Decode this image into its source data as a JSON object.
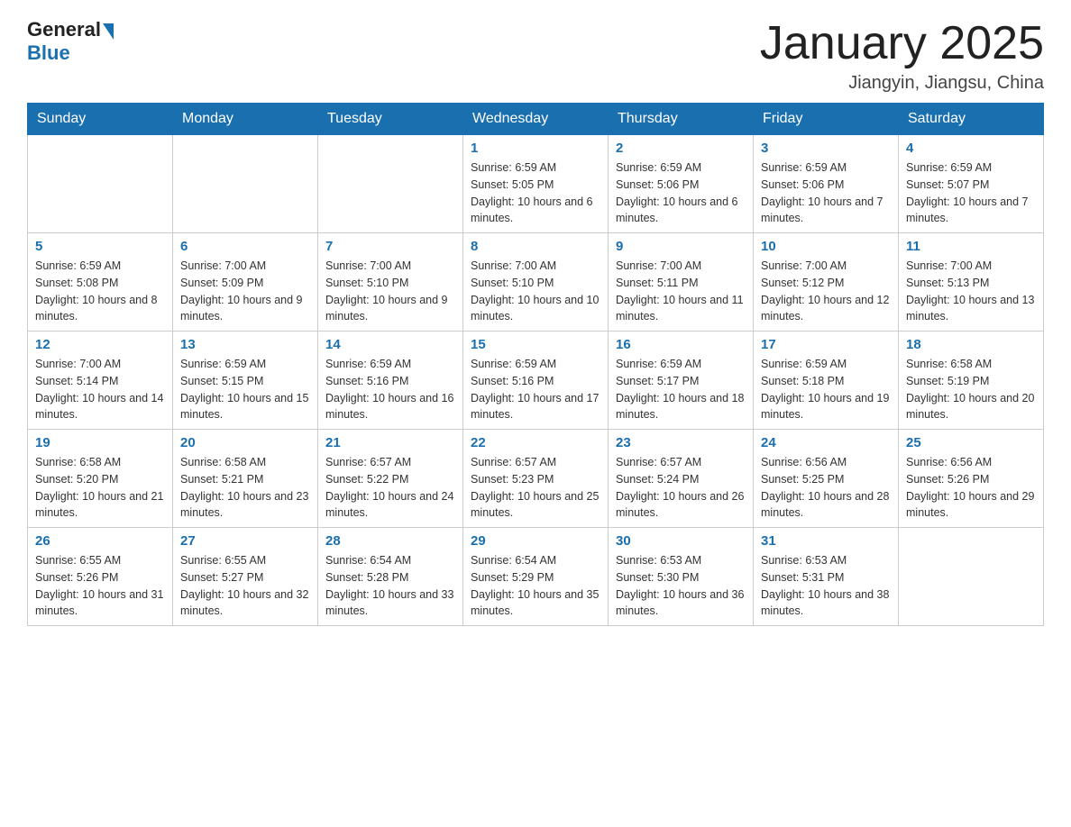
{
  "header": {
    "logo": {
      "general": "General",
      "blue": "Blue"
    },
    "title": "January 2025",
    "subtitle": "Jiangyin, Jiangsu, China"
  },
  "weekdays": [
    "Sunday",
    "Monday",
    "Tuesday",
    "Wednesday",
    "Thursday",
    "Friday",
    "Saturday"
  ],
  "weeks": [
    [
      {
        "day": "",
        "info": ""
      },
      {
        "day": "",
        "info": ""
      },
      {
        "day": "",
        "info": ""
      },
      {
        "day": "1",
        "info": "Sunrise: 6:59 AM\nSunset: 5:05 PM\nDaylight: 10 hours and 6 minutes."
      },
      {
        "day": "2",
        "info": "Sunrise: 6:59 AM\nSunset: 5:06 PM\nDaylight: 10 hours and 6 minutes."
      },
      {
        "day": "3",
        "info": "Sunrise: 6:59 AM\nSunset: 5:06 PM\nDaylight: 10 hours and 7 minutes."
      },
      {
        "day": "4",
        "info": "Sunrise: 6:59 AM\nSunset: 5:07 PM\nDaylight: 10 hours and 7 minutes."
      }
    ],
    [
      {
        "day": "5",
        "info": "Sunrise: 6:59 AM\nSunset: 5:08 PM\nDaylight: 10 hours and 8 minutes."
      },
      {
        "day": "6",
        "info": "Sunrise: 7:00 AM\nSunset: 5:09 PM\nDaylight: 10 hours and 9 minutes."
      },
      {
        "day": "7",
        "info": "Sunrise: 7:00 AM\nSunset: 5:10 PM\nDaylight: 10 hours and 9 minutes."
      },
      {
        "day": "8",
        "info": "Sunrise: 7:00 AM\nSunset: 5:10 PM\nDaylight: 10 hours and 10 minutes."
      },
      {
        "day": "9",
        "info": "Sunrise: 7:00 AM\nSunset: 5:11 PM\nDaylight: 10 hours and 11 minutes."
      },
      {
        "day": "10",
        "info": "Sunrise: 7:00 AM\nSunset: 5:12 PM\nDaylight: 10 hours and 12 minutes."
      },
      {
        "day": "11",
        "info": "Sunrise: 7:00 AM\nSunset: 5:13 PM\nDaylight: 10 hours and 13 minutes."
      }
    ],
    [
      {
        "day": "12",
        "info": "Sunrise: 7:00 AM\nSunset: 5:14 PM\nDaylight: 10 hours and 14 minutes."
      },
      {
        "day": "13",
        "info": "Sunrise: 6:59 AM\nSunset: 5:15 PM\nDaylight: 10 hours and 15 minutes."
      },
      {
        "day": "14",
        "info": "Sunrise: 6:59 AM\nSunset: 5:16 PM\nDaylight: 10 hours and 16 minutes."
      },
      {
        "day": "15",
        "info": "Sunrise: 6:59 AM\nSunset: 5:16 PM\nDaylight: 10 hours and 17 minutes."
      },
      {
        "day": "16",
        "info": "Sunrise: 6:59 AM\nSunset: 5:17 PM\nDaylight: 10 hours and 18 minutes."
      },
      {
        "day": "17",
        "info": "Sunrise: 6:59 AM\nSunset: 5:18 PM\nDaylight: 10 hours and 19 minutes."
      },
      {
        "day": "18",
        "info": "Sunrise: 6:58 AM\nSunset: 5:19 PM\nDaylight: 10 hours and 20 minutes."
      }
    ],
    [
      {
        "day": "19",
        "info": "Sunrise: 6:58 AM\nSunset: 5:20 PM\nDaylight: 10 hours and 21 minutes."
      },
      {
        "day": "20",
        "info": "Sunrise: 6:58 AM\nSunset: 5:21 PM\nDaylight: 10 hours and 23 minutes."
      },
      {
        "day": "21",
        "info": "Sunrise: 6:57 AM\nSunset: 5:22 PM\nDaylight: 10 hours and 24 minutes."
      },
      {
        "day": "22",
        "info": "Sunrise: 6:57 AM\nSunset: 5:23 PM\nDaylight: 10 hours and 25 minutes."
      },
      {
        "day": "23",
        "info": "Sunrise: 6:57 AM\nSunset: 5:24 PM\nDaylight: 10 hours and 26 minutes."
      },
      {
        "day": "24",
        "info": "Sunrise: 6:56 AM\nSunset: 5:25 PM\nDaylight: 10 hours and 28 minutes."
      },
      {
        "day": "25",
        "info": "Sunrise: 6:56 AM\nSunset: 5:26 PM\nDaylight: 10 hours and 29 minutes."
      }
    ],
    [
      {
        "day": "26",
        "info": "Sunrise: 6:55 AM\nSunset: 5:26 PM\nDaylight: 10 hours and 31 minutes."
      },
      {
        "day": "27",
        "info": "Sunrise: 6:55 AM\nSunset: 5:27 PM\nDaylight: 10 hours and 32 minutes."
      },
      {
        "day": "28",
        "info": "Sunrise: 6:54 AM\nSunset: 5:28 PM\nDaylight: 10 hours and 33 minutes."
      },
      {
        "day": "29",
        "info": "Sunrise: 6:54 AM\nSunset: 5:29 PM\nDaylight: 10 hours and 35 minutes."
      },
      {
        "day": "30",
        "info": "Sunrise: 6:53 AM\nSunset: 5:30 PM\nDaylight: 10 hours and 36 minutes."
      },
      {
        "day": "31",
        "info": "Sunrise: 6:53 AM\nSunset: 5:31 PM\nDaylight: 10 hours and 38 minutes."
      },
      {
        "day": "",
        "info": ""
      }
    ]
  ]
}
